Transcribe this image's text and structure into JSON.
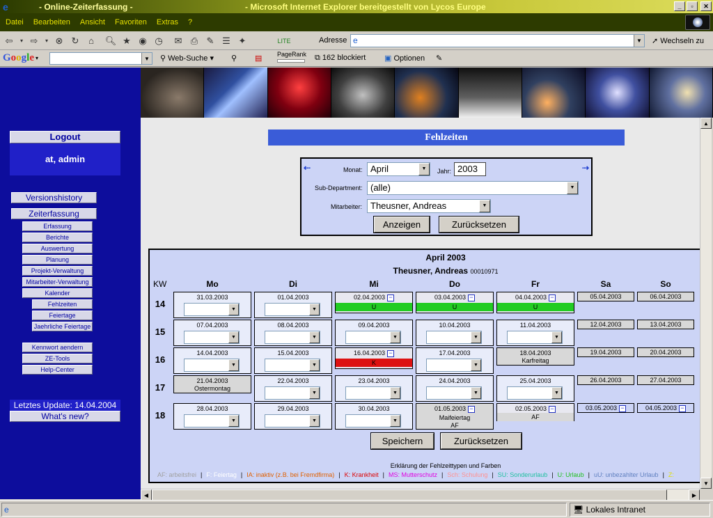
{
  "window": {
    "title_left": "- Online-Zeiterfassung -",
    "title_right": "- Microsoft Internet Explorer bereitgestellt von Lycos Europe",
    "min": "_",
    "max": "▫",
    "close": "✕"
  },
  "menu": [
    "Datei",
    "Bearbeiten",
    "Ansicht",
    "Favoriten",
    "Extras",
    "?"
  ],
  "toolbar": {
    "address_label": "Adresse",
    "address_value": "",
    "go_label": "Wechseln zu"
  },
  "googlebar": {
    "logo": "Google",
    "search_value": "",
    "websearch": "Web-Suche",
    "pagerank": "PageRank",
    "blocked": "162 blockiert",
    "options": "Optionen"
  },
  "nav": {
    "logout": "Logout",
    "user": "at, admin",
    "versionshistory": "Versionshistory",
    "zeiterfassung": "Zeiterfassung",
    "sub": [
      "Erfassung",
      "Berichte",
      "Auswertung",
      "Planung",
      "Projekt-Verwaltung",
      "Mitarbeiter-Verwaltung",
      "Kalender"
    ],
    "subsub": [
      "Fehlzeiten",
      "Feiertage",
      "Jaehrliche Feiertage"
    ],
    "extra": [
      "Kennwort aendern",
      "ZE-Tools",
      "Help-Center"
    ],
    "update": "Letztes Update: 14.04.2004",
    "whatsnew": "What's new?"
  },
  "page": {
    "title": "Fehlzeiten",
    "filter": {
      "monat_label": "Monat:",
      "monat_value": "April",
      "jahr_label": "Jahr:",
      "jahr_value": "2003",
      "subdept_label": "Sub-Department:",
      "subdept_value": "(alle)",
      "mitarbeiter_label": "Mitarbeiter:",
      "mitarbeiter_value": "Theusner, Andreas",
      "anzeigen": "Anzeigen",
      "reset": "Zurücksetzen"
    },
    "calendar": {
      "month": "April 2003",
      "person": "Theusner, Andreas",
      "person_id": "00010971",
      "kw_label": "KW",
      "days": [
        "Mo",
        "Di",
        "Mi",
        "Do",
        "Fr",
        "Sa",
        "So"
      ],
      "weeks": [
        {
          "kw": "14",
          "cells": [
            {
              "date": "31.03.2003",
              "kind": "select"
            },
            {
              "date": "01.04.2003",
              "kind": "select"
            },
            {
              "date": "02.04.2003",
              "kind": "status",
              "status": "U",
              "color": "#22cc22"
            },
            {
              "date": "03.04.2003",
              "kind": "status",
              "status": "U",
              "color": "#22cc22"
            },
            {
              "date": "04.04.2003",
              "kind": "status",
              "status": "U",
              "color": "#22cc22"
            },
            {
              "date": "05.04.2003",
              "kind": "weekend"
            },
            {
              "date": "06.04.2003",
              "kind": "weekend"
            }
          ]
        },
        {
          "kw": "15",
          "cells": [
            {
              "date": "07.04.2003",
              "kind": "select"
            },
            {
              "date": "08.04.2003",
              "kind": "select"
            },
            {
              "date": "09.04.2003",
              "kind": "select"
            },
            {
              "date": "10.04.2003",
              "kind": "select"
            },
            {
              "date": "11.04.2003",
              "kind": "select"
            },
            {
              "date": "12.04.2003",
              "kind": "weekend"
            },
            {
              "date": "13.04.2003",
              "kind": "weekend"
            }
          ]
        },
        {
          "kw": "16",
          "cells": [
            {
              "date": "14.04.2003",
              "kind": "select"
            },
            {
              "date": "15.04.2003",
              "kind": "select"
            },
            {
              "date": "16.04.2003",
              "kind": "status",
              "status": "K",
              "color": "#dd1111"
            },
            {
              "date": "17.04.2003",
              "kind": "select"
            },
            {
              "date": "18.04.2003",
              "kind": "holiday",
              "note": "Karfreitag"
            },
            {
              "date": "19.04.2003",
              "kind": "weekend"
            },
            {
              "date": "20.04.2003",
              "kind": "weekend"
            }
          ]
        },
        {
          "kw": "17",
          "cells": [
            {
              "date": "21.04.2003",
              "kind": "holiday",
              "note": "Ostermontag"
            },
            {
              "date": "22.04.2003",
              "kind": "select"
            },
            {
              "date": "23.04.2003",
              "kind": "select"
            },
            {
              "date": "24.04.2003",
              "kind": "select"
            },
            {
              "date": "25.04.2003",
              "kind": "select"
            },
            {
              "date": "26.04.2003",
              "kind": "weekend"
            },
            {
              "date": "27.04.2003",
              "kind": "weekend"
            }
          ]
        },
        {
          "kw": "18",
          "cells": [
            {
              "date": "28.04.2003",
              "kind": "select"
            },
            {
              "date": "29.04.2003",
              "kind": "select"
            },
            {
              "date": "30.04.2003",
              "kind": "select"
            },
            {
              "date": "01.05.2003",
              "kind": "holiday2",
              "note": "Maifeiertag",
              "status": "AF"
            },
            {
              "date": "02.05.2003",
              "kind": "af",
              "status": "AF"
            },
            {
              "date": "03.05.2003",
              "kind": "weekend2"
            },
            {
              "date": "04.05.2003",
              "kind": "weekend2"
            }
          ]
        }
      ],
      "save": "Speichern",
      "reset": "Zurücksetzen"
    },
    "legend": {
      "title": "Erklärung der Fehlzeittypen und Farben",
      "items": [
        {
          "text": "AF: arbeitsfrei",
          "color": "#a0a0a0"
        },
        {
          "text": "F: Feiertag",
          "color": "#ffffff"
        },
        {
          "text": "IA: inaktiv (z.B. bei Fremdfirma)",
          "color": "#e06000"
        },
        {
          "text": "K: Krankheit",
          "color": "#dd0000"
        },
        {
          "text": "MS: Mutterschutz",
          "color": "#e000e0"
        },
        {
          "text": "Sch: Schulung",
          "color": "#ff9090"
        },
        {
          "text": "SU: Sonderurlaub",
          "color": "#20c0a0"
        },
        {
          "text": "U: Urlaub",
          "color": "#20c020"
        },
        {
          "text": "uU: unbezahlter Urlaub",
          "color": "#6080c0"
        },
        {
          "text": "Z:",
          "color": "#e0e000"
        }
      ]
    }
  },
  "status": {
    "zone": "Lokales Intranet"
  },
  "colors": {
    "nav_bg": "#0d0d9c",
    "title_bar": "#3a5cd8",
    "panel": "#ccd4f6"
  }
}
